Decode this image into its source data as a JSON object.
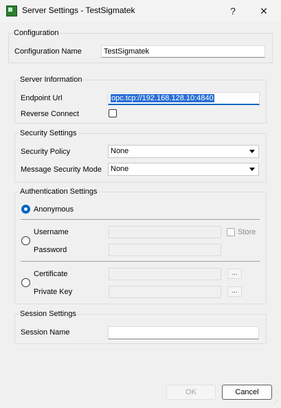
{
  "window": {
    "title": "Server Settings - TestSigmatek",
    "help_glyph": "?",
    "close_glyph": "✕",
    "app_icon": "sigmatek-app-icon"
  },
  "configuration": {
    "group_title": "Configuration",
    "name_label": "Configuration Name",
    "name_value": "TestSigmatek"
  },
  "server_information": {
    "group_title": "Server Information",
    "endpoint_label": "Endpoint Url",
    "endpoint_value": "opc.tcp://192.168.128.10:4840",
    "reverse_connect_label": "Reverse Connect",
    "reverse_connect_checked": false
  },
  "security_settings": {
    "group_title": "Security Settings",
    "policy_label": "Security Policy",
    "policy_value": "None",
    "mode_label": "Message Security Mode",
    "mode_value": "None"
  },
  "authentication": {
    "group_title": "Authentication Settings",
    "anonymous_label": "Anonymous",
    "anonymous_selected": true,
    "username_label": "Username",
    "password_label": "Password",
    "store_label": "Store",
    "certificate_label": "Certificate",
    "private_key_label": "Private Key",
    "browse_glyph": "..."
  },
  "session_settings": {
    "group_title": "Session Settings",
    "session_name_label": "Session Name",
    "session_name_value": ""
  },
  "buttons": {
    "ok_label": "OK",
    "cancel_label": "Cancel"
  },
  "colors": {
    "accent": "#0067c0",
    "selection": "#2a6fd6",
    "background": "#f0f0f0"
  }
}
